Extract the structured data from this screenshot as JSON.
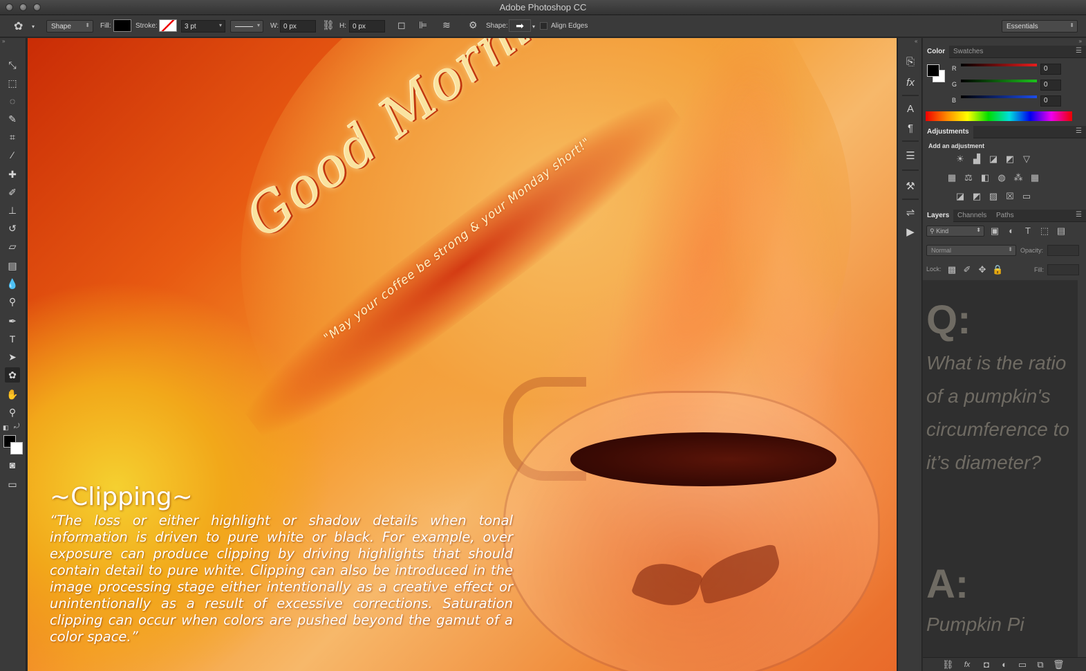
{
  "window": {
    "title": "Adobe Photoshop CC"
  },
  "options_bar": {
    "mode": "Shape",
    "fill_label": "Fill:",
    "stroke_label": "Stroke:",
    "stroke_width": "3 pt",
    "w_label": "W:",
    "w_value": "0 px",
    "h_label": "H:",
    "h_value": "0 px",
    "shape_label": "Shape:",
    "align_edges_label": "Align Edges",
    "workspace": "Essentials"
  },
  "canvas": {
    "title": "Good Morning",
    "subtitle": "\"May your coffee be strong & your Monday short!\"",
    "heading": "~Clipping~",
    "body": "“The loss or either highlight or shadow details when tonal information is driven to pure white or black. For example, over exposure can produce clipping by driving highlights that should contain detail to pure white. Clipping can also be introduced in the image processing stage either intentionally as a creative effect or unintentionally as a result of excessive corrections. Saturation clipping can occur when colors are pushed beyond the gamut of a color space.”"
  },
  "color_panel": {
    "tabs": [
      "Color",
      "Swatches"
    ],
    "r_label": "R",
    "r_value": "0",
    "g_label": "G",
    "g_value": "0",
    "b_label": "B",
    "b_value": "0"
  },
  "adjustments_panel": {
    "tab": "Adjustments",
    "heading": "Add an adjustment"
  },
  "layers_panel": {
    "tabs": [
      "Layers",
      "Channels",
      "Paths"
    ],
    "filter_kind": "Kind",
    "blend_mode": "Normal",
    "opacity_label": "Opacity:",
    "lock_label": "Lock:",
    "fill_label": "Fill:"
  },
  "qa": {
    "q_label": "Q:",
    "question": "What is the ratio of a pumpkin's circumference to it’s diameter?",
    "a_label": "A:",
    "answer": "Pumpkin Pi"
  },
  "colors": {
    "accent_red": "#e81c1c",
    "accent_green": "#1cc21c",
    "accent_blue": "#1c4ce8",
    "canvas_orange": "#e85a12"
  }
}
